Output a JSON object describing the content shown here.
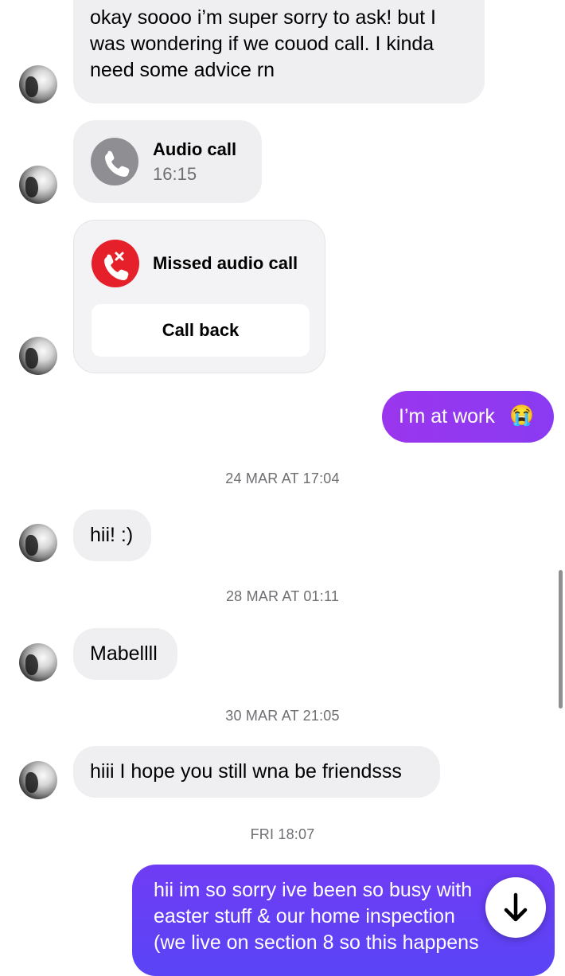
{
  "messages": {
    "m1_lines": [
      "okay soooo i’m super sorry to ask! but I",
      "was wondering if we couod call. I kinda",
      "need some advice rn"
    ],
    "audio_call": {
      "title": "Audio call",
      "time": "16:15"
    },
    "missed_call": {
      "title": "Missed audio call",
      "button": "Call back"
    },
    "out1": "I’m at work",
    "out1_emoji": "😭",
    "stamp1": "24 MAR AT 17:04",
    "m2": "hii! :)",
    "stamp2": "28 MAR AT 01:11",
    "m3": "Mabellll",
    "stamp3": "30 MAR AT 21:05",
    "m4": "hiii I hope you still wna be friendsss",
    "stamp4": "FRI 18:07",
    "out2_lines": [
      "hii im so sorry ive been so busy with",
      "easter stuff & our home inspection",
      "(we live on section 8 so this happens"
    ]
  },
  "colors": {
    "incoming_bubble": "#efeff2",
    "outgoing_gradient": [
      "#9338f0",
      "#6a3ff5"
    ],
    "missed_call_red": "#e5202a",
    "call_icon_gray": "#8e8e93"
  },
  "icons": {
    "audio_call": "phone-icon",
    "missed_call": "missed-call-icon",
    "scroll_down": "arrow-down-icon"
  }
}
